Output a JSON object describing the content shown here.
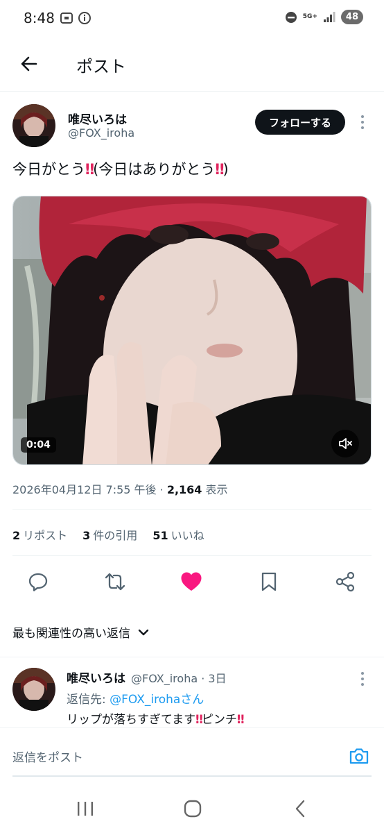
{
  "status_bar": {
    "time": "8:48",
    "network": "5G+",
    "battery": "48"
  },
  "header": {
    "title": "ポスト"
  },
  "tweet": {
    "author_name": "唯尽いろは",
    "author_handle": "@FOX_iroha",
    "follow_label": "フォローする",
    "text_part1": "今日がとう",
    "text_part2": "(今日はありがとう",
    "text_part3": ")",
    "emoji_bangbang": "‼",
    "video_duration": "0:04",
    "timestamp": "2026年04月12日 7:55 午後",
    "separator": " · ",
    "views_count": "2,164",
    "views_label": " 表示"
  },
  "stats": {
    "reposts_count": "2",
    "reposts_label": "リポスト",
    "quotes_count": "3",
    "quotes_label": "件の引用",
    "likes_count": "51",
    "likes_label": "いいね"
  },
  "actions": {
    "like_color": "#f91880",
    "icon_color": "#536471"
  },
  "replies": {
    "sort_label": "最も関連性の高い返信",
    "items": [
      {
        "name": "唯尽いろは",
        "handle_time": "@FOX_iroha · 3日",
        "reply_prefix": "返信先: ",
        "reply_target": "@FOX_irohaさん",
        "text_part1": "リップが落ちすぎてます",
        "text_part2": "ピンチ"
      }
    ]
  },
  "compose": {
    "placeholder": "返信をポスト"
  },
  "colors": {
    "accent": "#1d9bf0",
    "text": "#0f1419",
    "muted": "#536471"
  }
}
